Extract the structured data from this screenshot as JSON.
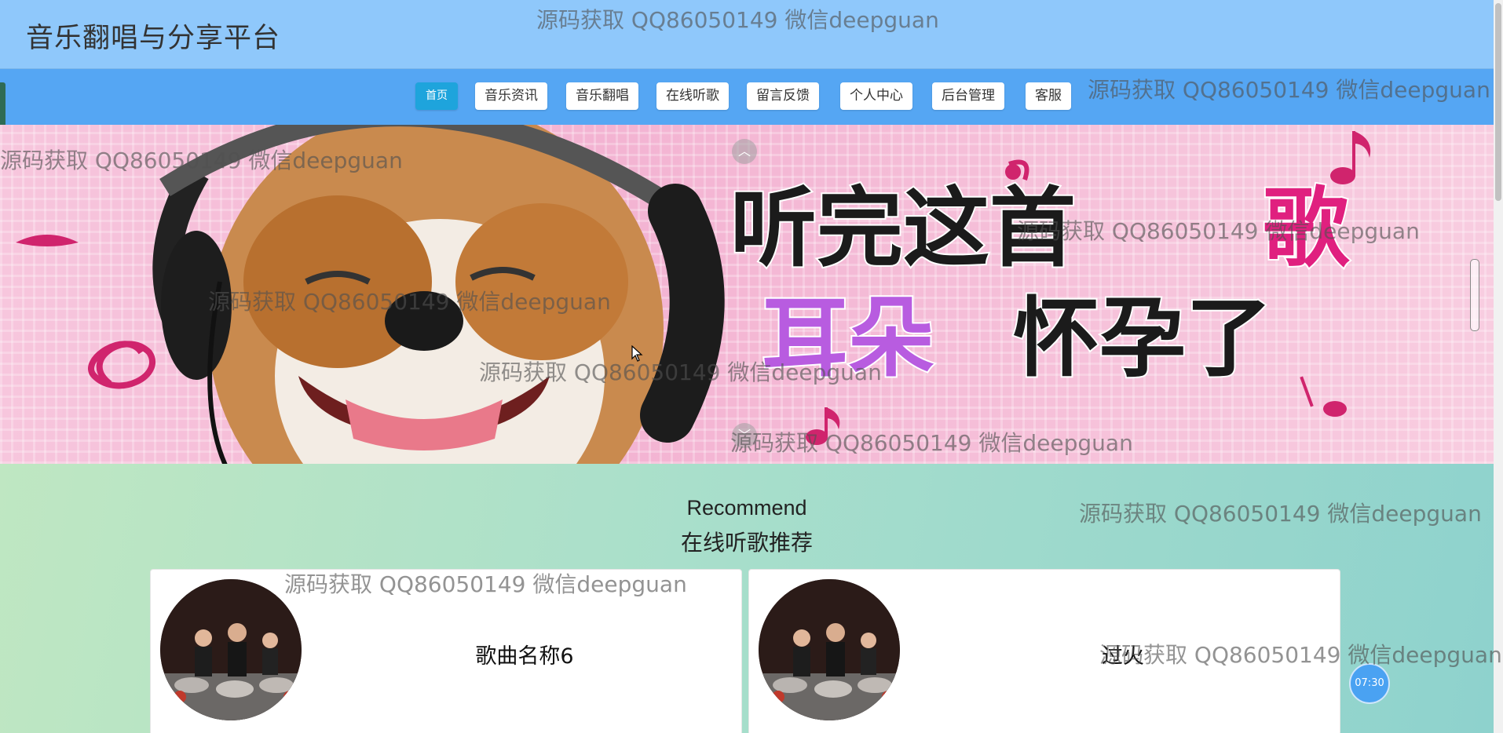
{
  "header": {
    "site_title": "音乐翻唱与分享平台"
  },
  "nav": {
    "items": [
      {
        "label": "首页",
        "active": true
      },
      {
        "label": "音乐资讯"
      },
      {
        "label": "音乐翻唱"
      },
      {
        "label": "在线听歌"
      },
      {
        "label": "留言反馈"
      },
      {
        "label": "个人中心"
      },
      {
        "label": "后台管理"
      },
      {
        "label": "客服"
      }
    ]
  },
  "banner": {
    "line1_black": "听完这首",
    "line1_accent": "歌",
    "line2_accent": "耳朵",
    "line2_black": "怀孕了",
    "colors": {
      "pink": "#e0207f",
      "purple": "#b85ce0"
    }
  },
  "recommend": {
    "title_en": "Recommend",
    "title_cn": "在线听歌推荐",
    "cards": [
      {
        "name": "歌曲名称6"
      },
      {
        "name": "过火"
      }
    ]
  },
  "timer": "07:30",
  "watermark": "源码获取 QQ86050149 微信deepguan"
}
